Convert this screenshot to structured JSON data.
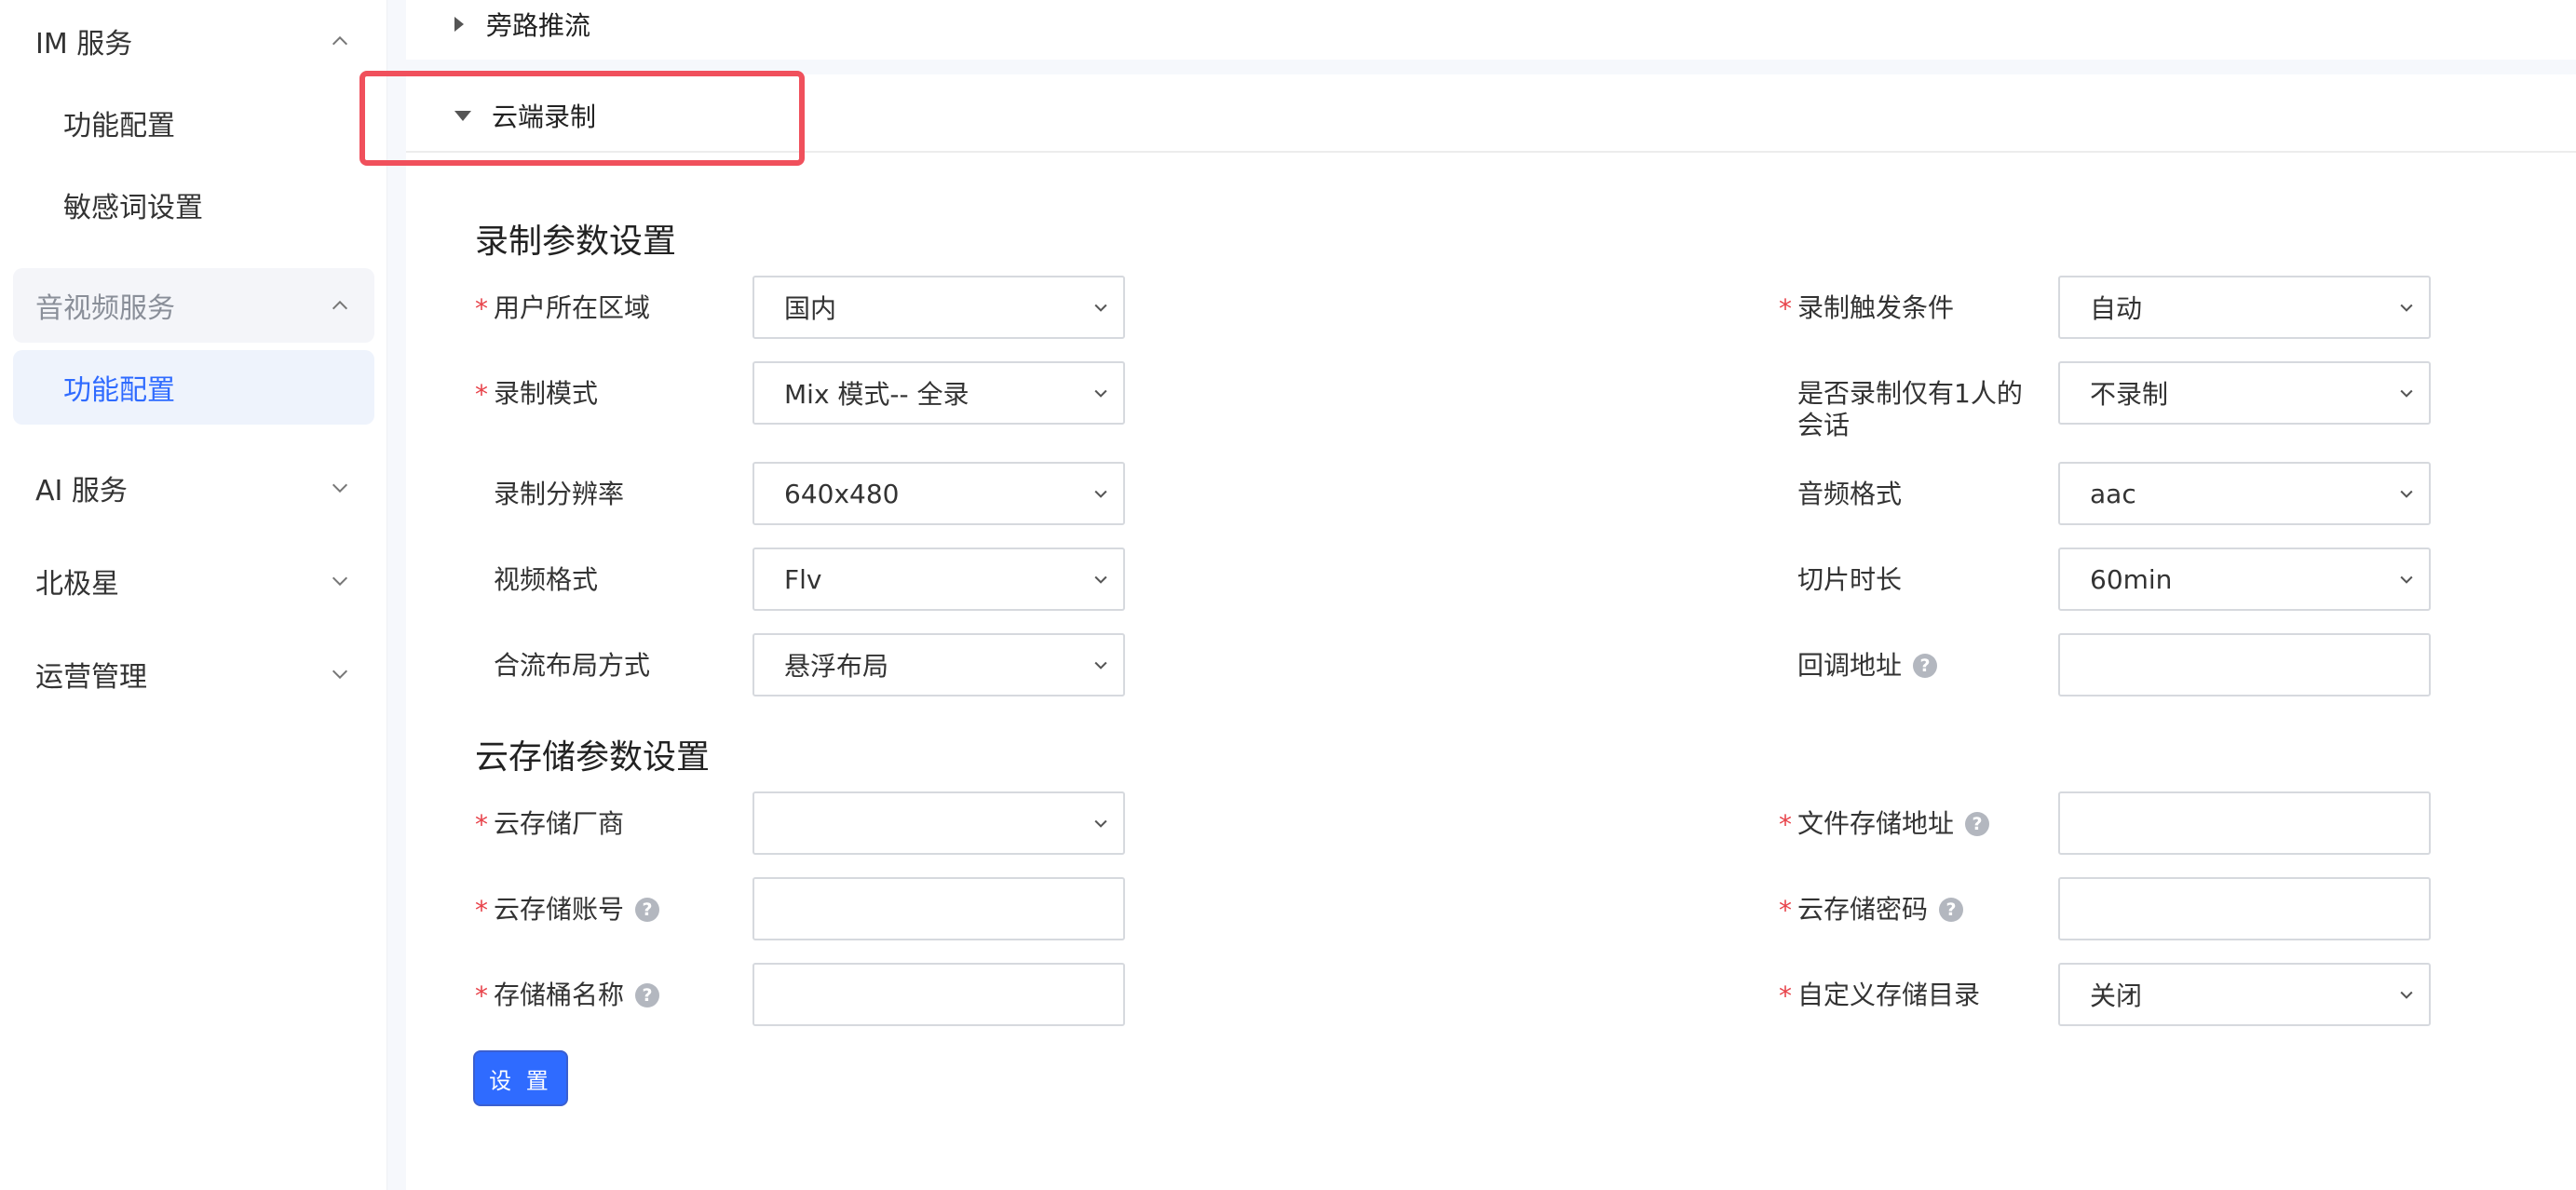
{
  "sidebar": {
    "groups": [
      {
        "label": "IM 服务",
        "expanded": true
      },
      {
        "label": "音视频服务",
        "expanded": true
      },
      {
        "label": "AI 服务",
        "expanded": false
      },
      {
        "label": "北极星",
        "expanded": false
      },
      {
        "label": "运营管理",
        "expanded": false
      }
    ],
    "im_items": [
      "功能配置",
      "敏感词设置"
    ],
    "av_items": [
      "功能配置"
    ],
    "selected_color": "#2f6bff"
  },
  "main": {
    "bypass_stream_label": "旁路推流",
    "cloud_recording_label": "云端录制",
    "highlight_color": "#f0505c"
  },
  "recording": {
    "section_title": "录制参数设置",
    "fields": [
      {
        "label": "用户所在区域",
        "required": true,
        "type": "select",
        "value": "国内"
      },
      {
        "label": "录制触发条件",
        "required": true,
        "type": "select",
        "value": "自动"
      },
      {
        "label": "录制模式",
        "required": true,
        "type": "select",
        "value": "Mix 模式-- 全录"
      },
      {
        "label": "是否录制仅有1人的会话",
        "required": false,
        "type": "select",
        "value": "不录制"
      },
      {
        "label": "录制分辨率",
        "required": false,
        "type": "select",
        "value": "640x480"
      },
      {
        "label": "音频格式",
        "required": false,
        "type": "select",
        "value": "aac"
      },
      {
        "label": "视频格式",
        "required": false,
        "type": "select",
        "value": "Flv"
      },
      {
        "label": "切片时长",
        "required": false,
        "type": "select",
        "value": "60min"
      },
      {
        "label": "合流布局方式",
        "required": false,
        "type": "select",
        "value": "悬浮布局"
      },
      {
        "label": "回调地址",
        "required": false,
        "type": "input",
        "value": "",
        "help": true
      }
    ]
  },
  "storage": {
    "section_title": "云存储参数设置",
    "fields": [
      {
        "label": "云存储厂商",
        "required": true,
        "type": "select",
        "value": ""
      },
      {
        "label": "文件存储地址",
        "required": true,
        "type": "input",
        "value": "",
        "help": true
      },
      {
        "label": "云存储账号",
        "required": true,
        "type": "input",
        "value": "",
        "help": true
      },
      {
        "label": "云存储密码",
        "required": true,
        "type": "input",
        "value": "",
        "help": true
      },
      {
        "label": "存储桶名称",
        "required": true,
        "type": "input",
        "value": "",
        "help": true
      },
      {
        "label": "自定义存储目录",
        "required": true,
        "type": "select",
        "value": "关闭"
      }
    ]
  },
  "actions": {
    "submit_label": "设 置",
    "submit_color": "#2f6bff"
  },
  "icons": {
    "required_mark": "*",
    "help": "?"
  }
}
